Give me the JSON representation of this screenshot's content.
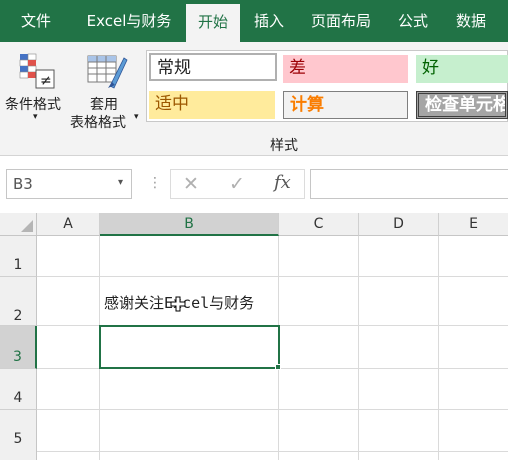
{
  "ribbon_tabs": [
    {
      "label": "文件"
    },
    {
      "label": "Excel与财务"
    },
    {
      "label": "开始"
    },
    {
      "label": "插入"
    },
    {
      "label": "页面布局"
    },
    {
      "label": "公式"
    },
    {
      "label": "数据"
    }
  ],
  "ribbon": {
    "conditional_format_label": "条件格式",
    "table_format_line1": "套用",
    "table_format_line2": "表格格式",
    "styles_group_label": "样式",
    "styles": {
      "normal": "常规",
      "bad": "差",
      "good": "好",
      "neutral": "适中",
      "calculation": "计算",
      "check_cell": "检查单元格"
    }
  },
  "formula_bar": {
    "name_box": "B3",
    "fx": "fx",
    "value": ""
  },
  "sheet": {
    "columns": [
      "A",
      "B",
      "C",
      "D",
      "E"
    ],
    "rows": [
      "1",
      "2",
      "3",
      "4",
      "5"
    ],
    "cell_B2": "感谢关注Excel与财务",
    "selected_cell": "B3"
  },
  "colors": {
    "accent": "#217346",
    "bad_fill": "#ffc7ce",
    "bad_text": "#9c0006",
    "good_fill": "#c6efce",
    "good_text": "#006100",
    "neutral_fill": "#ffeb9c",
    "neutral_text": "#9c5700",
    "calc_text": "#fa7d00"
  }
}
